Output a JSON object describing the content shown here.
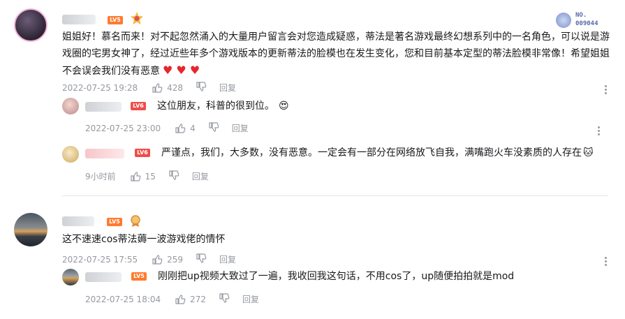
{
  "comments": [
    {
      "level": "LV5",
      "text": "姐姐好！慕名而来！对不起忽然涌入的大量用户留言会对您造成疑惑，蒂法是著名游戏最终幻想系列中的一名角色，可以说是游戏圈的宅男女神了，经过近些年多个游戏版本的更新蒂法的脸模也在发生变化，您和目前基本定型的蒂法脸模非常像！希望姐姐不会误会我们没有恶意",
      "hearts": "♥ ♥ ♥",
      "time": "2022-07-25 19:28",
      "likes": "428",
      "reply_label": "回复",
      "badge": "NO.\n009044",
      "replies": [
        {
          "level": "LV6",
          "text": "这位朋友，科普的很到位。",
          "emoji": "😍",
          "time": "2022-07-25 23:00",
          "likes": "4",
          "reply_label": "回复"
        },
        {
          "level": "LV6",
          "text": "严谨点，我们，大多数，没有恶意。一定会有一部分在网络放飞自我，满嘴跑火车没素质的人存在",
          "emoji": "🐱",
          "time": "9小时前",
          "likes": "15",
          "reply_label": "回复"
        }
      ]
    },
    {
      "level": "LV5",
      "text": "这不速速cos蒂法薅一波游戏佬的情怀",
      "time": "2022-07-25 17:55",
      "likes": "259",
      "reply_label": "回复",
      "replies": [
        {
          "level": "LV5",
          "text": "刚刚把up视频大致过了一遍，我收回我这句话，不用cos了，up随便拍拍就是mod",
          "time": "2022-07-25 18:04",
          "likes": "272",
          "reply_label": "回复"
        }
      ]
    }
  ],
  "colors": {
    "accent_lv5": "#ff7a2e",
    "accent_lv6": "#f04c49",
    "meta_text": "#9499a0",
    "heart": "#e6262e"
  }
}
